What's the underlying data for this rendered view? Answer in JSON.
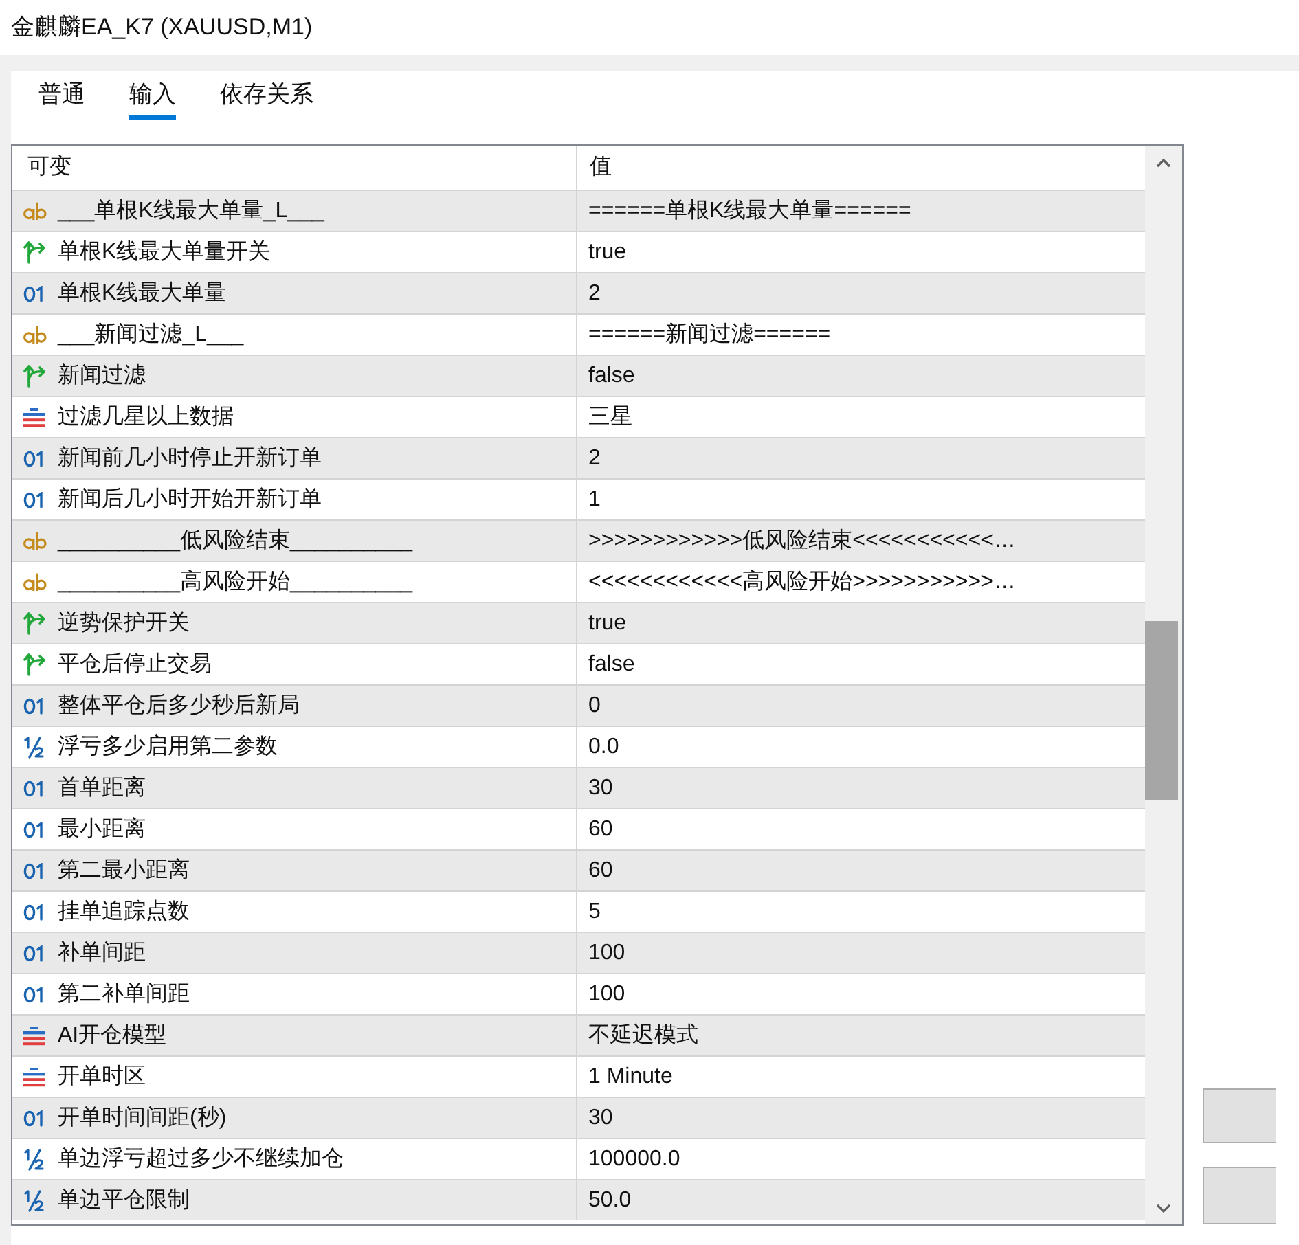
{
  "window": {
    "title": "金麒麟EA_K7 (XAUUSD,M1)"
  },
  "tabs": [
    {
      "label": "普通",
      "selected": false
    },
    {
      "label": "输入",
      "selected": true
    },
    {
      "label": "依存关系",
      "selected": false
    }
  ],
  "table": {
    "columns": [
      "可变",
      "值"
    ],
    "rows": [
      {
        "kind": "string",
        "name": "___单根K线最大单量_L___",
        "value": "======单根K线最大单量======"
      },
      {
        "kind": "bool",
        "name": "单根K线最大单量开关",
        "value": "true"
      },
      {
        "kind": "int",
        "name": "单根K线最大单量",
        "value": "2"
      },
      {
        "kind": "string",
        "name": "___新闻过滤_L___",
        "value": "======新闻过滤======"
      },
      {
        "kind": "bool",
        "name": "新闻过滤",
        "value": "false"
      },
      {
        "kind": "enum",
        "name": "过滤几星以上数据",
        "value": "三星"
      },
      {
        "kind": "int",
        "name": "新闻前几小时停止开新订单",
        "value": "2"
      },
      {
        "kind": "int",
        "name": "新闻后几小时开始开新订单",
        "value": "1"
      },
      {
        "kind": "string",
        "name": "__________低风险结束__________",
        "value": ">>>>>>>>>>>>低风险结束<<<<<<<<<<<…"
      },
      {
        "kind": "string",
        "name": "__________高风险开始__________",
        "value": "<<<<<<<<<<<<高风险开始>>>>>>>>>>>…"
      },
      {
        "kind": "bool",
        "name": "逆势保护开关",
        "value": "true"
      },
      {
        "kind": "bool",
        "name": "平仓后停止交易",
        "value": "false"
      },
      {
        "kind": "int",
        "name": "整体平仓后多少秒后新局",
        "value": "0"
      },
      {
        "kind": "double",
        "name": "浮亏多少启用第二参数",
        "value": "0.0"
      },
      {
        "kind": "int",
        "name": "首单距离",
        "value": "30"
      },
      {
        "kind": "int",
        "name": "最小距离",
        "value": "60"
      },
      {
        "kind": "int",
        "name": "第二最小距离",
        "value": "60"
      },
      {
        "kind": "int",
        "name": "挂单追踪点数",
        "value": "5"
      },
      {
        "kind": "int",
        "name": "补单间距",
        "value": "100"
      },
      {
        "kind": "int",
        "name": "第二补单间距",
        "value": "100"
      },
      {
        "kind": "enum",
        "name": "AI开仓模型",
        "value": "不延迟模式"
      },
      {
        "kind": "enum",
        "name": "开单时区",
        "value": "1 Minute"
      },
      {
        "kind": "int",
        "name": "开单时间间距(秒)",
        "value": "30"
      },
      {
        "kind": "double",
        "name": "单边浮亏超过多少不继续加仓",
        "value": "100000.0"
      },
      {
        "kind": "double",
        "name": "单边平仓限制",
        "value": "50.0"
      }
    ]
  }
}
